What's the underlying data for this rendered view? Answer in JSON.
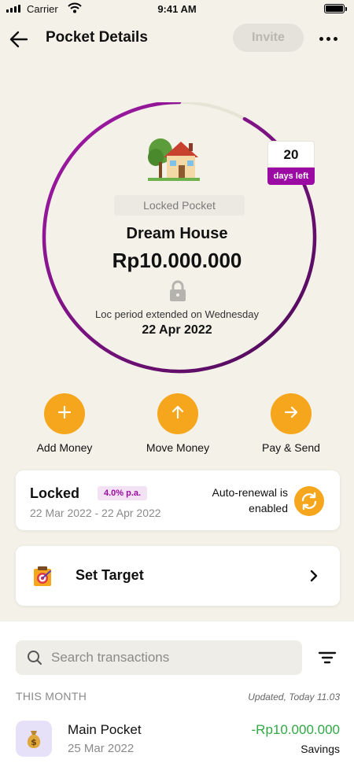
{
  "status_bar": {
    "carrier": "Carrier",
    "time": "9:41 AM"
  },
  "header": {
    "title": "Pocket Details",
    "invite_label": "Invite"
  },
  "pocket": {
    "emoji": "🏡",
    "status_label": "Locked Pocket",
    "name": "Dream House",
    "amount": "Rp10.000.000",
    "lock_note": "Loc period extended on Wednesday",
    "lock_date": "22 Apr 2022",
    "days_left_value": "20",
    "days_left_label": "days left",
    "ring_progress": 0.92
  },
  "actions": [
    {
      "label": "Add Money",
      "icon": "plus-icon"
    },
    {
      "label": "Move Money",
      "icon": "arrow-up-icon"
    },
    {
      "label": "Pay & Send",
      "icon": "arrow-right-icon"
    }
  ],
  "lock_card": {
    "title": "Locked",
    "rate": "4.0% p.a.",
    "period": "22 Mar 2022 - 22 Apr 2022",
    "auto_renewal_line1": "Auto-renewal is",
    "auto_renewal_line2": "enabled"
  },
  "target_card": {
    "label": "Set Target"
  },
  "transactions": {
    "search_placeholder": "Search transactions",
    "month_label": "THIS MONTH",
    "updated": "Updated, Today 11.03",
    "items": [
      {
        "name": "Main Pocket",
        "date": "25 Mar 2022",
        "amount": "-Rp10.000.000",
        "type": "Savings",
        "icon": "money-bag-icon"
      }
    ]
  },
  "colors": {
    "background": "#f3f1e8",
    "accent_orange": "#f6a61c",
    "accent_purple": "#9b0ba3",
    "amount_green": "#2fa844"
  }
}
